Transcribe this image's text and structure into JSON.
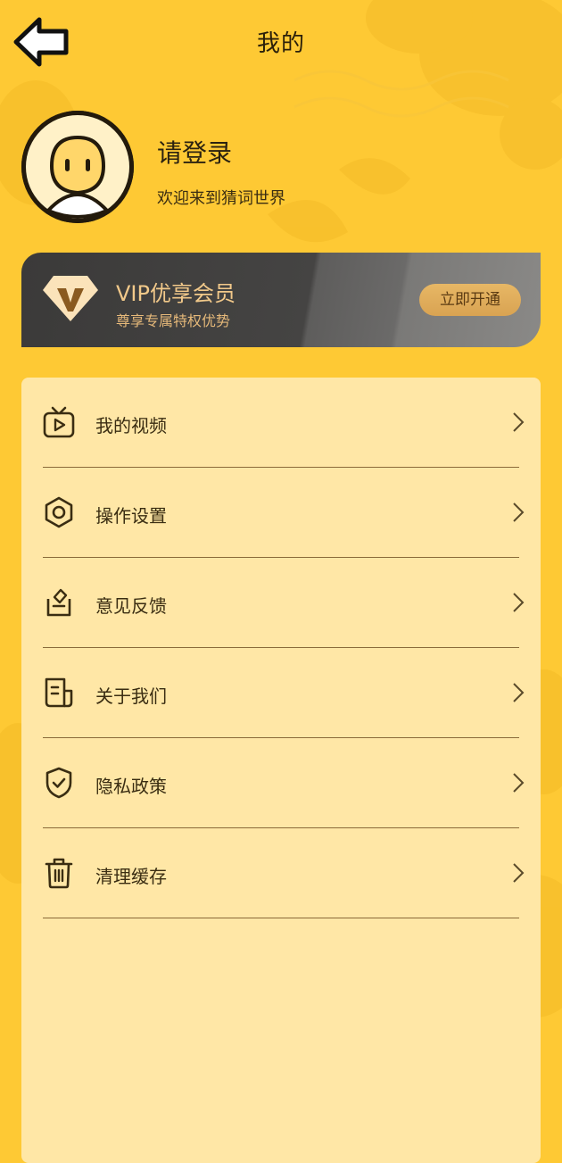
{
  "header": {
    "title": "我的",
    "back_icon": "arrow-left-icon"
  },
  "profile": {
    "name": "请登录",
    "welcome": "欢迎来到猜词世界"
  },
  "vip": {
    "title": "VIP优享会员",
    "subtitle": "尊享专属特权优势",
    "button": "立即开通"
  },
  "menu": [
    {
      "label": "我的视频",
      "icon": "tv-play-icon"
    },
    {
      "label": "操作设置",
      "icon": "hexagon-gear-icon"
    },
    {
      "label": "意见反馈",
      "icon": "feedback-icon"
    },
    {
      "label": "关于我们",
      "icon": "document-icon"
    },
    {
      "label": "隐私政策",
      "icon": "shield-check-icon"
    },
    {
      "label": "清理缓存",
      "icon": "trash-icon"
    }
  ],
  "colors": {
    "background": "#FEC934",
    "panel": "#FFE7A6",
    "vip_card": "#3B3A39",
    "vip_gold": "#E7B765"
  }
}
